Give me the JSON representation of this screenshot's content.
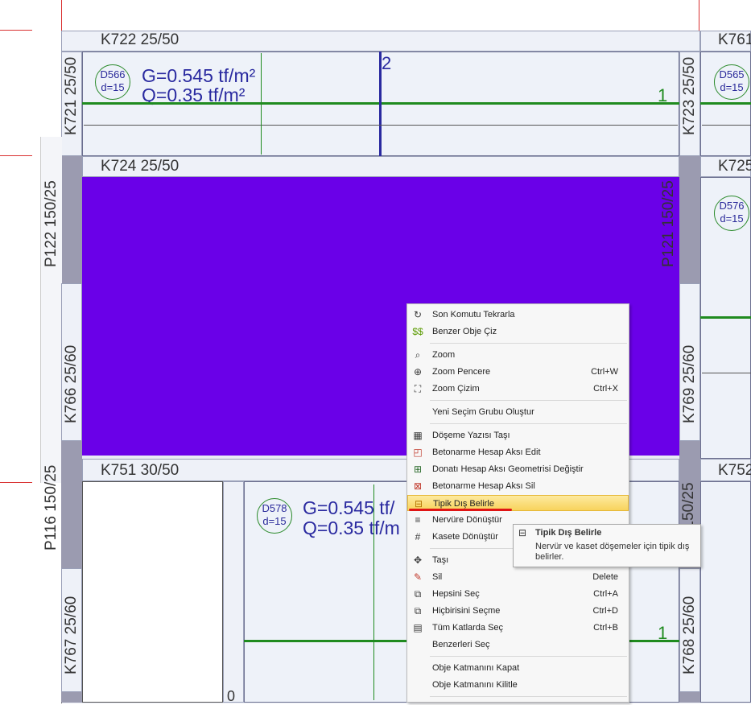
{
  "drawing": {
    "beams": {
      "k722": "K722 25/50",
      "k761": "K761",
      "k724": "K724 25/50",
      "k725": "K725",
      "k751": "K751 30/50",
      "k752": "K752",
      "k721": "K721 25/50",
      "k723": "K723 25/50",
      "k766": "K766 25/60",
      "k769": "K769 25/60",
      "k767": "K767 25/60",
      "k768": "K768 25/60"
    },
    "columns": {
      "p122": "P122 150/25",
      "p121": "P121 150/25",
      "p116": "P116 150/25",
      "p116b": "16 150/25"
    },
    "slabs": {
      "d566_name": "D566",
      "d566_thk": "d=15",
      "d565_name": "D565",
      "d565_thk": "d=15",
      "d576_name": "D576",
      "d576_thk": "d=15",
      "d578_name": "D578",
      "d578_thk": "d=15"
    },
    "loads": {
      "g1": "G=0.545 tf/m²",
      "q1": "Q=0.35 tf/m²",
      "g2": "G=0.545 tf/",
      "q2": "Q=0.35 tf/m"
    },
    "axis_marks": {
      "a2": "2",
      "a1_top": "1",
      "a1_bottom": "1",
      "zero": "0"
    },
    "colors": {
      "selected_slab": "#6a00e8",
      "axis_green": "#1f8b1f",
      "axis_blue": "#2a2aa0",
      "grid_red": "#d93030"
    }
  },
  "context_menu": {
    "items": [
      {
        "label": "Son Komutu Tekrarla",
        "shortcut": "",
        "icon": "repeat-icon"
      },
      {
        "label": "Benzer Obje Çiz",
        "shortcut": "",
        "icon": "similar-draw-icon"
      },
      {
        "label": "Zoom",
        "shortcut": "",
        "icon": "zoom-icon"
      },
      {
        "label": "Zoom Pencere",
        "shortcut": "Ctrl+W",
        "icon": "zoom-window-icon"
      },
      {
        "label": "Zoom Çizim",
        "shortcut": "Ctrl+X",
        "icon": "zoom-extents-icon"
      },
      {
        "label": "Yeni Seçim Grubu Oluştur",
        "shortcut": "",
        "icon": ""
      },
      {
        "label": "Döşeme Yazısı Taşı",
        "shortcut": "",
        "icon": "slab-text-move-icon"
      },
      {
        "label": "Betonarme Hesap Aksı Edit",
        "shortcut": "",
        "icon": "axis-edit-icon"
      },
      {
        "label": "Donatı Hesap Aksı Geometrisi Değiştir",
        "shortcut": "",
        "icon": "axis-geometry-icon"
      },
      {
        "label": "Betonarme Hesap Aksı Sil",
        "shortcut": "",
        "icon": "axis-delete-icon"
      },
      {
        "label": "Tipik Dış Belirle",
        "shortcut": "",
        "icon": "typical-outer-icon"
      },
      {
        "label": "Nervüre Dönüştür",
        "shortcut": "",
        "icon": "rib-convert-icon"
      },
      {
        "label": "Kasete Dönüştür",
        "shortcut": "",
        "icon": "waffle-convert-icon"
      },
      {
        "label": "Taşı",
        "shortcut": "",
        "icon": "move-icon"
      },
      {
        "label": "Sil",
        "shortcut": "Delete",
        "icon": "erase-icon"
      },
      {
        "label": "Hepsini Seç",
        "shortcut": "Ctrl+A",
        "icon": "select-all-icon"
      },
      {
        "label": "Hiçbirisini Seçme",
        "shortcut": "Ctrl+D",
        "icon": "select-none-icon"
      },
      {
        "label": "Tüm Katlarda Seç",
        "shortcut": "Ctrl+B",
        "icon": "select-all-floors-icon"
      },
      {
        "label": "Benzerleri Seç",
        "shortcut": "",
        "icon": ""
      },
      {
        "label": "Obje Katmanını Kapat",
        "shortcut": "",
        "icon": ""
      },
      {
        "label": "Obje Katmanını Kilitle",
        "shortcut": "",
        "icon": ""
      }
    ]
  },
  "tooltip": {
    "title": "Tipik Dış Belirle",
    "body": "Nervür ve kaset döşemeler için tipik dış belirler."
  }
}
